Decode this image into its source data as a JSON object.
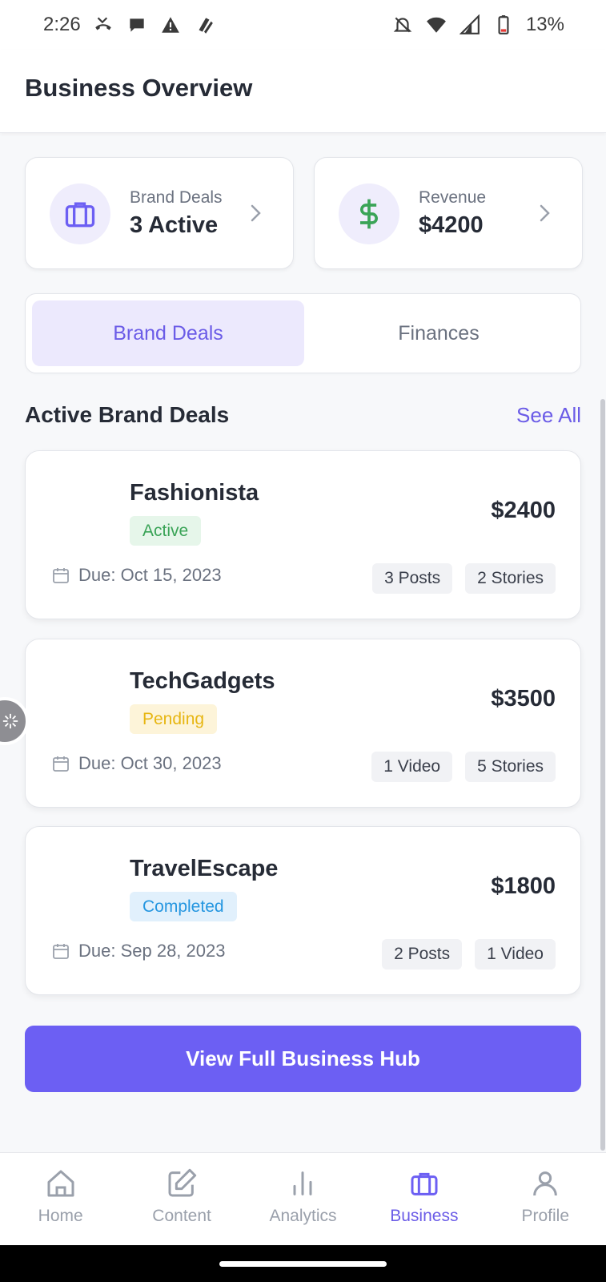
{
  "status_bar": {
    "time": "2:26",
    "battery": "13%",
    "icons_left": [
      "missed-call-icon",
      "chat-icon",
      "warning-icon",
      "app-icon"
    ],
    "icons_right": [
      "notifications-off-icon",
      "wifi-icon",
      "signal-icon",
      "battery-icon"
    ]
  },
  "header": {
    "title": "Business Overview"
  },
  "summary": [
    {
      "label": "Brand Deals",
      "value": "3 Active",
      "icon": "briefcase-icon"
    },
    {
      "label": "Revenue",
      "value": "$4200",
      "icon": "dollar-icon"
    }
  ],
  "tabs": [
    {
      "label": "Brand Deals",
      "active": true
    },
    {
      "label": "Finances",
      "active": false
    }
  ],
  "section": {
    "title": "Active Brand Deals",
    "see_all": "See All"
  },
  "deals": [
    {
      "name": "Fashionista",
      "status": "Active",
      "amount": "$2400",
      "due": "Due: Oct 15, 2023",
      "chips": [
        "3 Posts",
        "2 Stories"
      ]
    },
    {
      "name": "TechGadgets",
      "status": "Pending",
      "amount": "$3500",
      "due": "Due: Oct 30, 2023",
      "chips": [
        "1 Video",
        "5 Stories"
      ]
    },
    {
      "name": "TravelEscape",
      "status": "Completed",
      "amount": "$1800",
      "due": "Due: Sep 28, 2023",
      "chips": [
        "2 Posts",
        "1 Video"
      ]
    }
  ],
  "primary_button": "View Full Business Hub",
  "bottom_nav": [
    {
      "label": "Home",
      "icon": "home-icon",
      "active": false
    },
    {
      "label": "Content",
      "icon": "edit-icon",
      "active": false
    },
    {
      "label": "Analytics",
      "icon": "bar-chart-icon",
      "active": false
    },
    {
      "label": "Business",
      "icon": "briefcase-icon",
      "active": true
    },
    {
      "label": "Profile",
      "icon": "user-icon",
      "active": false
    }
  ],
  "colors": {
    "accent": "#6c5ff3",
    "active_status": "#3aa457",
    "pending_status": "#e7b612",
    "completed_status": "#2596e0",
    "revenue_icon": "#3aa457"
  }
}
